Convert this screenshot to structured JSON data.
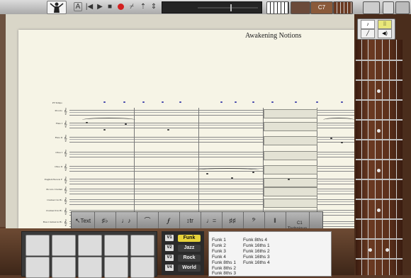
{
  "toolbar": {
    "position_readout": "",
    "chord_label": "C7"
  },
  "score": {
    "title": "Awakening Notions",
    "instruments": [
      "PVTempo",
      "Piccolo",
      "Flute I",
      "Flute II",
      "Oboe I",
      "Oboe II",
      "English Horn in F",
      "Piccolo Clarinet",
      "Clarinet I in B♭",
      "Clarinet II in B♭",
      "Bass Clarinet in B♭"
    ]
  },
  "palette": {
    "text_label": "Text",
    "technique_label": "C1\nTechnique"
  },
  "genres": {
    "voice_tags": [
      "V1",
      "V2",
      "V3",
      "V4"
    ],
    "items": [
      {
        "label": "Funk",
        "selected": true
      },
      {
        "label": "Jazz",
        "selected": false
      },
      {
        "label": "Rock",
        "selected": false
      },
      {
        "label": "World",
        "selected": false
      }
    ]
  },
  "patterns": {
    "col1": [
      "Funk 1",
      "Funk 2",
      "Funk 3",
      "Funk 4",
      "Funk 8ths 1",
      "Funk 8ths 2",
      "Funk 8ths 3"
    ],
    "col2": [
      "Funk 8ths 4",
      "Funk 16ths 1",
      "Funk 16ths 2",
      "Funk 16ths 3",
      "Funk 16ths 4"
    ]
  },
  "colors": {
    "selected_genre": "#e6d23a",
    "record": "#d32020",
    "tempo_marks": "#3d3fa8"
  }
}
